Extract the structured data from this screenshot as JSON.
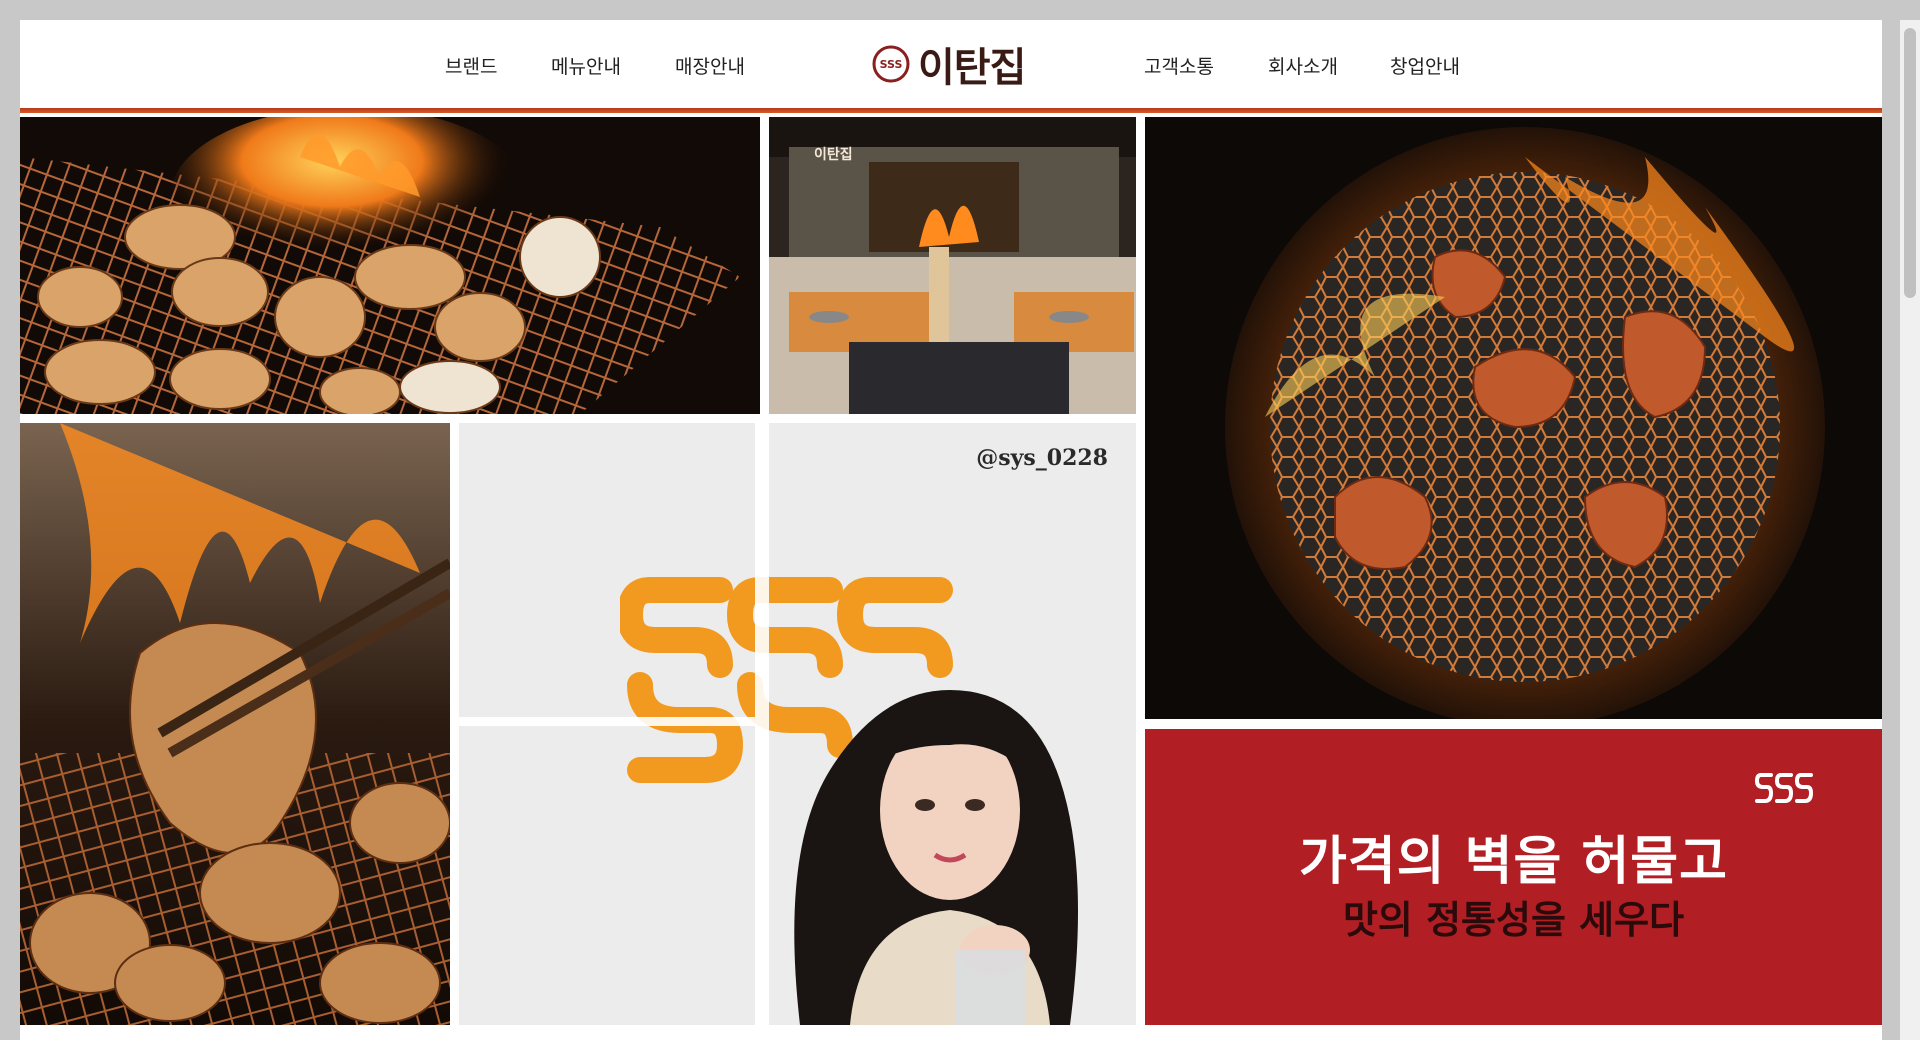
{
  "header": {
    "nav_left": [
      "브랜드",
      "메뉴안내",
      "매장안내"
    ],
    "logo_text": "이탄집",
    "nav_right": [
      "고객소통",
      "회사소개",
      "창업안내"
    ]
  },
  "tiles": {
    "interior_sign": "이탄집",
    "social_handle": "@sys_0228",
    "promo_title": "가격의 벽을 허물고",
    "promo_subtitle": "맛의 정통성을 세우다"
  },
  "colors": {
    "accent": "#c0392b",
    "brand_orange": "#f29a1f",
    "promo_red": "#b11e24",
    "logo_dark": "#3a1a14"
  }
}
